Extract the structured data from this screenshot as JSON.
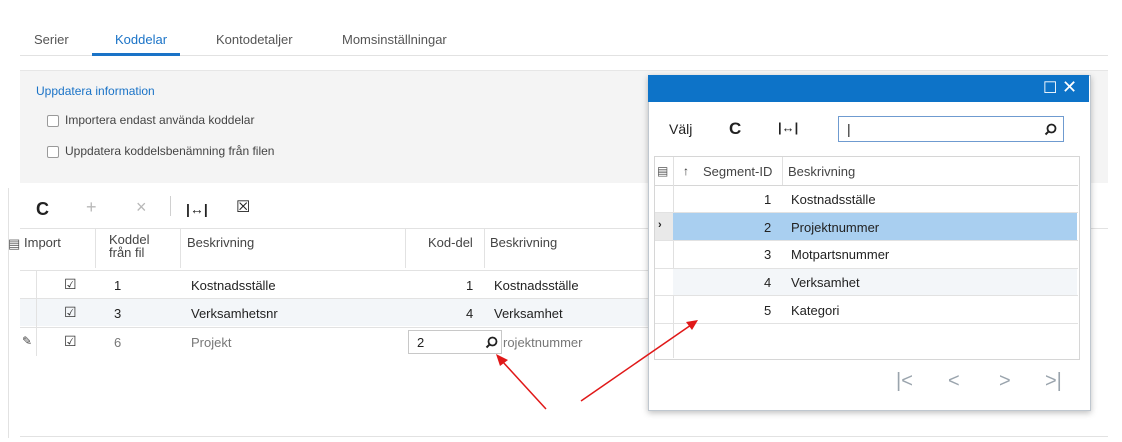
{
  "tabs": [
    {
      "label": "Serier",
      "active": false
    },
    {
      "label": "Koddelar",
      "active": true
    },
    {
      "label": "Kontodetaljer",
      "active": false
    },
    {
      "label": "Momsinställningar",
      "active": false
    }
  ],
  "info": {
    "title": "Uppdatera information",
    "options": [
      {
        "label": "Importera endast använda koddelar",
        "checked": false
      },
      {
        "label": "Uppdatera koddelsbenämning från filen",
        "checked": false
      }
    ]
  },
  "toolbar": {
    "refresh_icon": "C",
    "add_icon": "+",
    "delete_icon": "×",
    "fit_icon": "|↔|",
    "export_icon": "☒"
  },
  "grid": {
    "columns": {
      "import": "Import",
      "koddel_line1": "Koddel",
      "koddel_line2": "från fil",
      "beskrivning": "Beskrivning",
      "kod_del": "Kod-del",
      "beskrivning2": "Beskrivning"
    },
    "rows": [
      {
        "checked": true,
        "koddel": "1",
        "beskrivning": "Kostnadsställe",
        "kod_del": "1",
        "beskrivning2": "Kostnadsställe"
      },
      {
        "checked": true,
        "koddel": "3",
        "beskrivning": "Verksamhetsnr",
        "kod_del": "4",
        "beskrivning2": "Verksamhet"
      },
      {
        "checked": true,
        "koddel": "6",
        "beskrivning": "Projekt",
        "kod_del": "2",
        "beskrivning2": "rojektnummer"
      }
    ]
  },
  "popup": {
    "select_label": "Välj",
    "search_value": "",
    "columns": {
      "segment_id": "Segment-ID",
      "beskrivning": "Beskrivning"
    },
    "rows": [
      {
        "id": "1",
        "beskrivning": "Kostnadsställe"
      },
      {
        "id": "2",
        "beskrivning": "Projektnummer"
      },
      {
        "id": "3",
        "beskrivning": "Motpartsnummer"
      },
      {
        "id": "4",
        "beskrivning": "Verksamhet"
      },
      {
        "id": "5",
        "beskrivning": "Kategori"
      }
    ],
    "selected_row": 2
  },
  "colors": {
    "accent": "#0d73c8",
    "selection": "#a9cff0",
    "annotation_arrow": "#e01818"
  }
}
